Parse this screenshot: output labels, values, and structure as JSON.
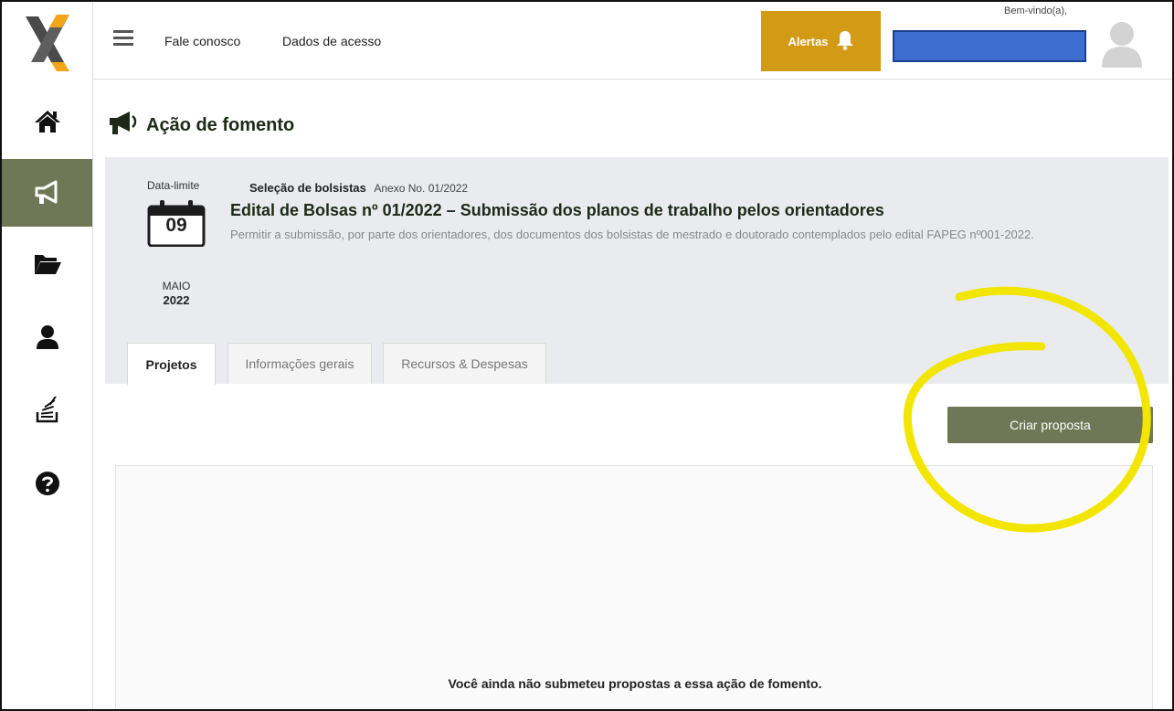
{
  "topbar": {
    "links": [
      "Fale conosco",
      "Dados de acesso"
    ],
    "alerts_label": "Alertas",
    "welcome": "Bem-vindo(a),"
  },
  "sidebar": {
    "items": [
      {
        "icon": "home-icon"
      },
      {
        "icon": "megaphone-icon",
        "active": true
      },
      {
        "icon": "folder-open-icon"
      },
      {
        "icon": "user-icon"
      },
      {
        "icon": "stack-icon"
      },
      {
        "icon": "help-icon"
      }
    ]
  },
  "page": {
    "title": "Ação de fomento",
    "deadline_label": "Data-limite",
    "deadline_day": "09",
    "deadline_month": "MAIO",
    "deadline_year": "2022",
    "selection_title": "Seleção de bolsistas",
    "selection_annex": "Anexo No. 01/2022",
    "edital_title": "Edital de Bolsas nº 01/2022 – Submissão dos planos de trabalho pelos orientadores",
    "edital_description": "Permitir a submissão, por parte dos orientadores, dos documentos dos bolsistas de mestrado e doutorado contemplados pelo edital FAPEG nº001-2022."
  },
  "tabs": [
    {
      "label": "Projetos",
      "active": true
    },
    {
      "label": "Informações gerais",
      "active": false
    },
    {
      "label": "Recursos & Despesas",
      "active": false
    }
  ],
  "actions": {
    "create_proposal": "Criar proposta"
  },
  "empty_state": {
    "message": "Você ainda não submeteu propostas a essa ação de fomento."
  },
  "colors": {
    "accent": "#6f7756",
    "alerts": "#d39a15",
    "user_box": "#3c6fcf",
    "annotation": "#f2e600"
  }
}
